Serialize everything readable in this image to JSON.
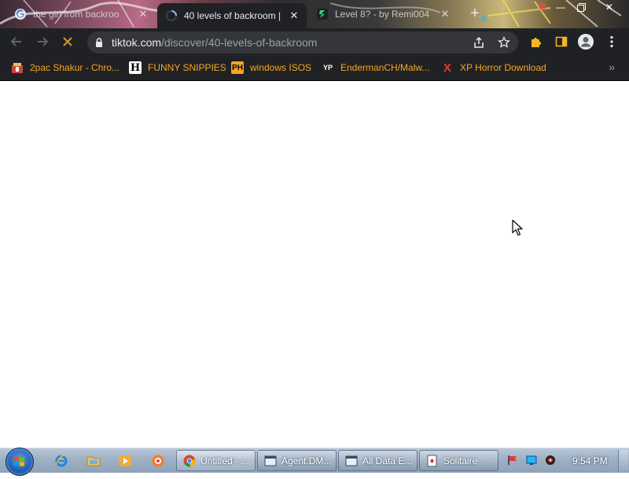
{
  "browser": {
    "tabs": [
      {
        "title": "the girl from backroo",
        "icon": "google-icon",
        "active": false
      },
      {
        "title": "40 levels of backroom |",
        "icon": "loading-spinner-icon",
        "active": true
      },
      {
        "title": "Level 8? - by Remi004",
        "icon": "site-icon",
        "active": false
      }
    ],
    "new_tab_icon": "plus-icon",
    "window_controls": [
      "minimize-icon",
      "restore-icon",
      "close-icon"
    ]
  },
  "toolbar": {
    "url_host": "tiktok.com",
    "url_path": "/discover/40-levels-of-backroom",
    "icons": [
      "back-arrow-icon",
      "forward-arrow-icon",
      "stop-loading-icon",
      "lock-icon",
      "share-icon",
      "bookmark-star-icon",
      "extensions-puzzle-icon",
      "side-panel-icon",
      "profile-avatar-icon",
      "more-menu-icon"
    ]
  },
  "bookmarks": [
    {
      "label": "2pac Shakur - Chro...",
      "icon": "bookmark-favicon"
    },
    {
      "label": "FUNNY SNIPPIES",
      "icon": "H"
    },
    {
      "label": "windows ISOS",
      "icon": "PH"
    },
    {
      "label": "EndermanCH/Malw...",
      "icon": "YP"
    },
    {
      "label": "XP Horror Download",
      "icon": "X"
    }
  ],
  "bookmarks_overflow": "»",
  "taskbar": {
    "quick_launch": [
      "ie-icon",
      "explorer-folder-icon",
      "media-player-icon",
      "app-icon"
    ],
    "tasks": [
      {
        "label": "Untitled - ...",
        "icon": "chrome-icon",
        "active": true
      },
      {
        "label": "Agent.DM...",
        "icon": "window-icon",
        "active": false
      },
      {
        "label": "All Data E...",
        "icon": "window-icon",
        "active": false
      },
      {
        "label": "Solitaire",
        "icon": "solitaire-icon",
        "active": false
      }
    ],
    "tray_icons": [
      "flag-icon",
      "monitor-icon",
      "volume-icon"
    ],
    "clock": "9:54 PM"
  },
  "colors": {
    "chrome_dark": "#202124",
    "omnibox": "#35363a",
    "bookmark_text": "#f5a623",
    "taskbar": "#9eb0c4"
  }
}
